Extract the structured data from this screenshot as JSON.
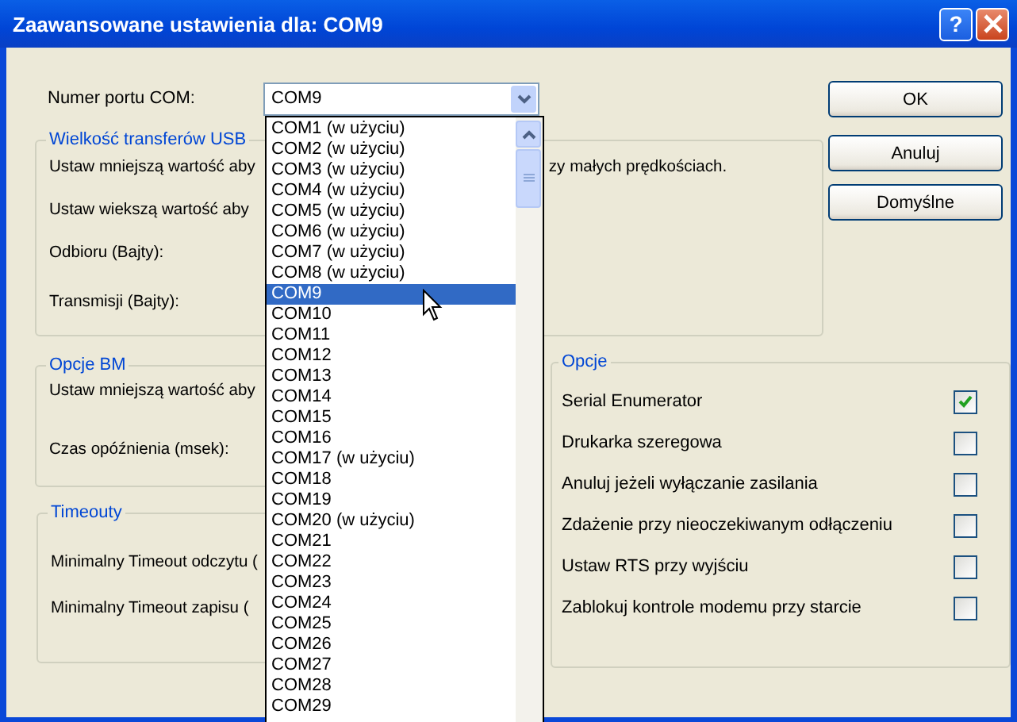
{
  "window": {
    "title": "Zaawansowane ustawienia dla: COM9",
    "help": "?"
  },
  "com_port": {
    "label": "Numer portu COM:",
    "value": "COM9"
  },
  "dropdown_items": [
    {
      "text": "COM1 (w użyciu)",
      "selected": false
    },
    {
      "text": "COM2 (w użyciu)",
      "selected": false
    },
    {
      "text": "COM3 (w użyciu)",
      "selected": false
    },
    {
      "text": "COM4 (w użyciu)",
      "selected": false
    },
    {
      "text": "COM5 (w użyciu)",
      "selected": false
    },
    {
      "text": "COM6 (w użyciu)",
      "selected": false
    },
    {
      "text": "COM7 (w użyciu)",
      "selected": false
    },
    {
      "text": "COM8 (w użyciu)",
      "selected": false
    },
    {
      "text": "COM9",
      "selected": true
    },
    {
      "text": "COM10",
      "selected": false
    },
    {
      "text": "COM11",
      "selected": false
    },
    {
      "text": "COM12",
      "selected": false
    },
    {
      "text": "COM13",
      "selected": false
    },
    {
      "text": "COM14",
      "selected": false
    },
    {
      "text": "COM15",
      "selected": false
    },
    {
      "text": "COM16",
      "selected": false
    },
    {
      "text": "COM17 (w użyciu)",
      "selected": false
    },
    {
      "text": "COM18",
      "selected": false
    },
    {
      "text": "COM19",
      "selected": false
    },
    {
      "text": "COM20 (w użyciu)",
      "selected": false
    },
    {
      "text": "COM21",
      "selected": false
    },
    {
      "text": "COM22",
      "selected": false
    },
    {
      "text": "COM23",
      "selected": false
    },
    {
      "text": "COM24",
      "selected": false
    },
    {
      "text": "COM25",
      "selected": false
    },
    {
      "text": "COM26",
      "selected": false
    },
    {
      "text": "COM27",
      "selected": false
    },
    {
      "text": "COM28",
      "selected": false
    },
    {
      "text": "COM29",
      "selected": false
    }
  ],
  "usb_group": {
    "title": "Wielkość transferów USB",
    "line_1": "Ustaw mniejszą wartość aby",
    "line_1_end": "zy małych prędkościach.",
    "line_2": "Ustaw wiekszą wartość aby",
    "receive_label": "Odbioru (Bajty):",
    "transmit_label": "Transmisji (Bajty):"
  },
  "bm_group": {
    "title": "Opcje BM",
    "line_1": "Ustaw mniejszą wartość aby",
    "latency_label": "Czas opóźnienia (msek):"
  },
  "timeouts_group": {
    "title": "Timeouty",
    "read_label": "Minimalny Timeout odczytu (",
    "write_label": "Minimalny Timeout zapisu ("
  },
  "options_group": {
    "title": "Opcje",
    "options": [
      {
        "label": "Serial Enumerator",
        "checked": true
      },
      {
        "label": "Drukarka szeregowa",
        "checked": false
      },
      {
        "label": "Anuluj jeżeli wyłączanie zasilania",
        "checked": false
      },
      {
        "label": "Zdażenie przy nieoczekiwanym odłączeniu",
        "checked": false
      },
      {
        "label": "Ustaw RTS przy wyjściu",
        "checked": false
      },
      {
        "label": "Zablokuj kontrole modemu przy starcie",
        "checked": false
      }
    ]
  },
  "buttons": [
    "OK",
    "Anuluj",
    "Domyślne"
  ]
}
